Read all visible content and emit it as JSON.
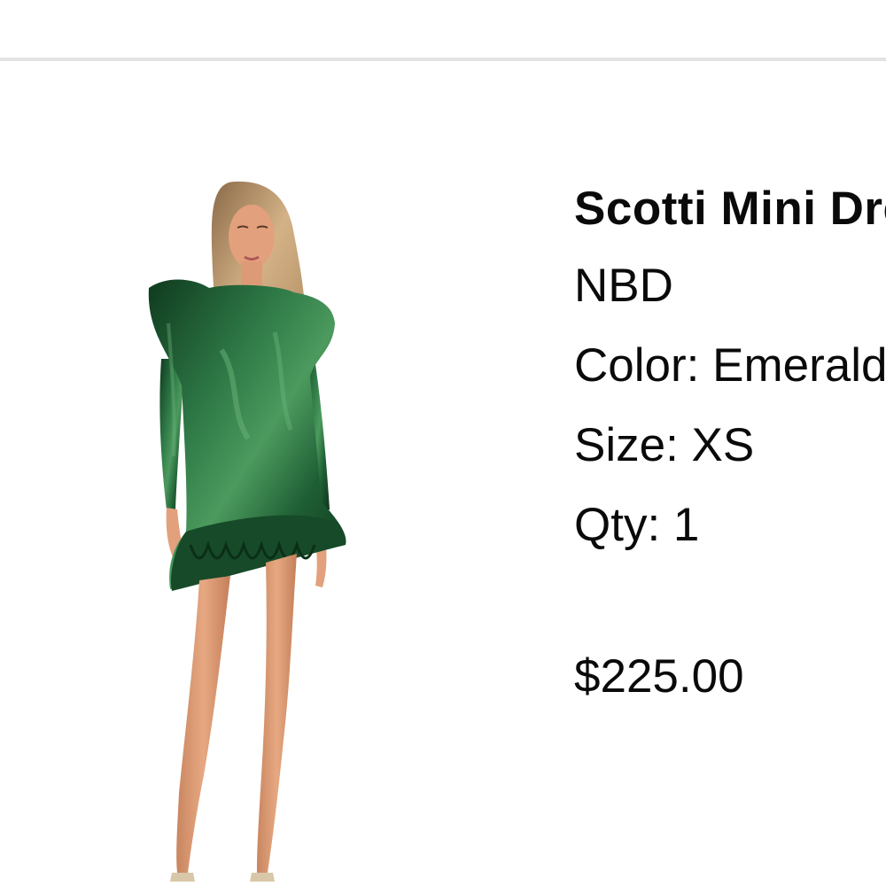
{
  "product": {
    "name": "Scotti Mini Dress",
    "brand": "NBD",
    "color_line": "Color: Emerald",
    "size_line": "Size: XS",
    "qty_line": "Qty: 1",
    "price": "$225.00"
  },
  "colors": {
    "dress": "#1f5f35",
    "dress_dark": "#0f3a1e",
    "dress_highlight": "#4c9a5e",
    "hair": "#c9a57a",
    "skin": "#e2a17c",
    "divider": "#e3e3e3"
  }
}
